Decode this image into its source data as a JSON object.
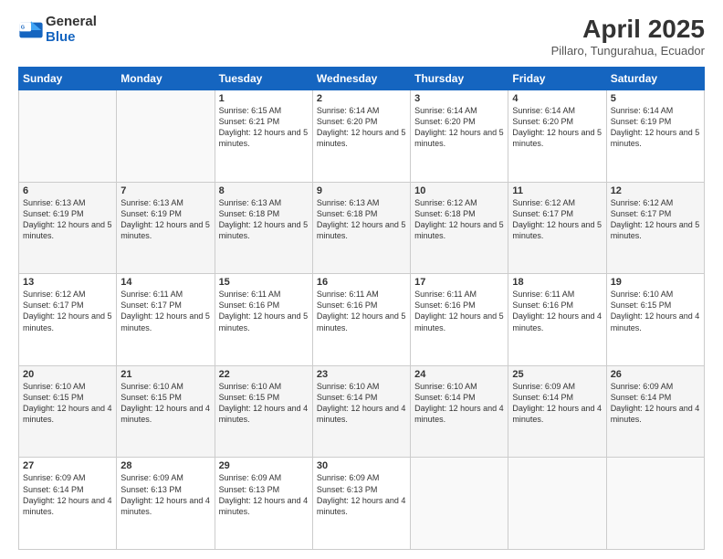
{
  "header": {
    "logo_general": "General",
    "logo_blue": "Blue",
    "month_title": "April 2025",
    "location": "Pillaro, Tungurahua, Ecuador"
  },
  "days_of_week": [
    "Sunday",
    "Monday",
    "Tuesday",
    "Wednesday",
    "Thursday",
    "Friday",
    "Saturday"
  ],
  "weeks": [
    [
      {
        "day": "",
        "info": ""
      },
      {
        "day": "",
        "info": ""
      },
      {
        "day": "1",
        "info": "Sunrise: 6:15 AM\nSunset: 6:21 PM\nDaylight: 12 hours and 5 minutes."
      },
      {
        "day": "2",
        "info": "Sunrise: 6:14 AM\nSunset: 6:20 PM\nDaylight: 12 hours and 5 minutes."
      },
      {
        "day": "3",
        "info": "Sunrise: 6:14 AM\nSunset: 6:20 PM\nDaylight: 12 hours and 5 minutes."
      },
      {
        "day": "4",
        "info": "Sunrise: 6:14 AM\nSunset: 6:20 PM\nDaylight: 12 hours and 5 minutes."
      },
      {
        "day": "5",
        "info": "Sunrise: 6:14 AM\nSunset: 6:19 PM\nDaylight: 12 hours and 5 minutes."
      }
    ],
    [
      {
        "day": "6",
        "info": "Sunrise: 6:13 AM\nSunset: 6:19 PM\nDaylight: 12 hours and 5 minutes."
      },
      {
        "day": "7",
        "info": "Sunrise: 6:13 AM\nSunset: 6:19 PM\nDaylight: 12 hours and 5 minutes."
      },
      {
        "day": "8",
        "info": "Sunrise: 6:13 AM\nSunset: 6:18 PM\nDaylight: 12 hours and 5 minutes."
      },
      {
        "day": "9",
        "info": "Sunrise: 6:13 AM\nSunset: 6:18 PM\nDaylight: 12 hours and 5 minutes."
      },
      {
        "day": "10",
        "info": "Sunrise: 6:12 AM\nSunset: 6:18 PM\nDaylight: 12 hours and 5 minutes."
      },
      {
        "day": "11",
        "info": "Sunrise: 6:12 AM\nSunset: 6:17 PM\nDaylight: 12 hours and 5 minutes."
      },
      {
        "day": "12",
        "info": "Sunrise: 6:12 AM\nSunset: 6:17 PM\nDaylight: 12 hours and 5 minutes."
      }
    ],
    [
      {
        "day": "13",
        "info": "Sunrise: 6:12 AM\nSunset: 6:17 PM\nDaylight: 12 hours and 5 minutes."
      },
      {
        "day": "14",
        "info": "Sunrise: 6:11 AM\nSunset: 6:17 PM\nDaylight: 12 hours and 5 minutes."
      },
      {
        "day": "15",
        "info": "Sunrise: 6:11 AM\nSunset: 6:16 PM\nDaylight: 12 hours and 5 minutes."
      },
      {
        "day": "16",
        "info": "Sunrise: 6:11 AM\nSunset: 6:16 PM\nDaylight: 12 hours and 5 minutes."
      },
      {
        "day": "17",
        "info": "Sunrise: 6:11 AM\nSunset: 6:16 PM\nDaylight: 12 hours and 5 minutes."
      },
      {
        "day": "18",
        "info": "Sunrise: 6:11 AM\nSunset: 6:16 PM\nDaylight: 12 hours and 4 minutes."
      },
      {
        "day": "19",
        "info": "Sunrise: 6:10 AM\nSunset: 6:15 PM\nDaylight: 12 hours and 4 minutes."
      }
    ],
    [
      {
        "day": "20",
        "info": "Sunrise: 6:10 AM\nSunset: 6:15 PM\nDaylight: 12 hours and 4 minutes."
      },
      {
        "day": "21",
        "info": "Sunrise: 6:10 AM\nSunset: 6:15 PM\nDaylight: 12 hours and 4 minutes."
      },
      {
        "day": "22",
        "info": "Sunrise: 6:10 AM\nSunset: 6:15 PM\nDaylight: 12 hours and 4 minutes."
      },
      {
        "day": "23",
        "info": "Sunrise: 6:10 AM\nSunset: 6:14 PM\nDaylight: 12 hours and 4 minutes."
      },
      {
        "day": "24",
        "info": "Sunrise: 6:10 AM\nSunset: 6:14 PM\nDaylight: 12 hours and 4 minutes."
      },
      {
        "day": "25",
        "info": "Sunrise: 6:09 AM\nSunset: 6:14 PM\nDaylight: 12 hours and 4 minutes."
      },
      {
        "day": "26",
        "info": "Sunrise: 6:09 AM\nSunset: 6:14 PM\nDaylight: 12 hours and 4 minutes."
      }
    ],
    [
      {
        "day": "27",
        "info": "Sunrise: 6:09 AM\nSunset: 6:14 PM\nDaylight: 12 hours and 4 minutes."
      },
      {
        "day": "28",
        "info": "Sunrise: 6:09 AM\nSunset: 6:13 PM\nDaylight: 12 hours and 4 minutes."
      },
      {
        "day": "29",
        "info": "Sunrise: 6:09 AM\nSunset: 6:13 PM\nDaylight: 12 hours and 4 minutes."
      },
      {
        "day": "30",
        "info": "Sunrise: 6:09 AM\nSunset: 6:13 PM\nDaylight: 12 hours and 4 minutes."
      },
      {
        "day": "",
        "info": ""
      },
      {
        "day": "",
        "info": ""
      },
      {
        "day": "",
        "info": ""
      }
    ]
  ]
}
